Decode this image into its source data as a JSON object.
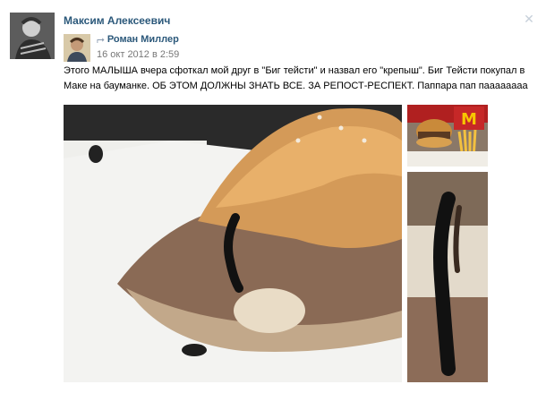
{
  "post": {
    "author": "Максим Алексеевич",
    "repost": {
      "author": "Роман Миллер",
      "date": "16 окт 2012 в 2:59"
    },
    "text": "Этого МАЛЫША вчера сфоткал мой друг в \"Биг тейсти\" и назвал его \"крепыш\". Биг Тейсти покупал в Маке на бауманке. ОБ ЭТОМ ДОЛЖНЫ ЗНАТЬ ВСЕ. ЗА РЕПОСТ-РЕСПЕКТ. Паппара пап паааааааа"
  },
  "icons": {
    "close": "close-icon",
    "repost": "repost-arrow-icon"
  },
  "colors": {
    "link": "#2b587a",
    "date": "#777777",
    "close": "#c7d0da"
  }
}
